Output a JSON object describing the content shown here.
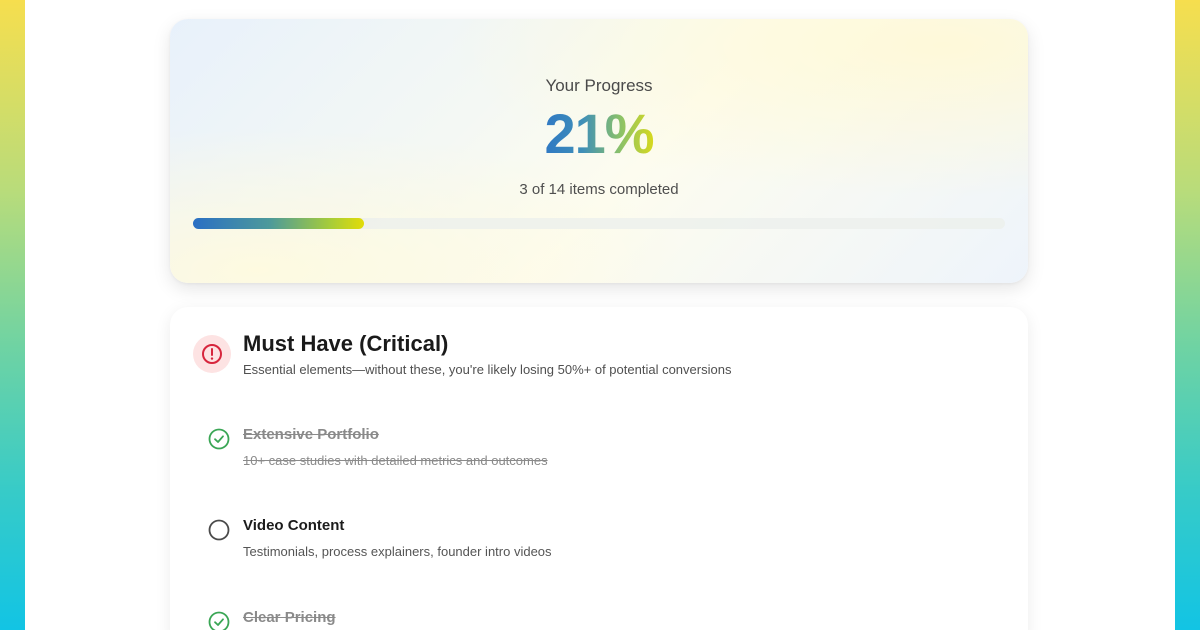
{
  "progress": {
    "label": "Your Progress",
    "percent": "21%",
    "summary": "3 of 14 items completed",
    "fraction": 0.21
  },
  "section": {
    "title": "Must Have (Critical)",
    "description": "Essential elements—without these, you're likely losing 50%+ of potential conversions",
    "icon": "alert-circle-icon",
    "items": [
      {
        "title": "Extensive Portfolio",
        "description": "10+ case studies with detailed metrics and outcomes",
        "completed": true
      },
      {
        "title": "Video Content",
        "description": "Testimonials, process explainers, founder intro videos",
        "completed": false
      },
      {
        "title": "Clear Pricing",
        "description": "",
        "completed": true
      }
    ]
  },
  "colors": {
    "accent_blue": "#2f78c4",
    "accent_yellow": "#d8d91d",
    "check_green": "#3aa655",
    "alert_red": "#d7263d"
  }
}
